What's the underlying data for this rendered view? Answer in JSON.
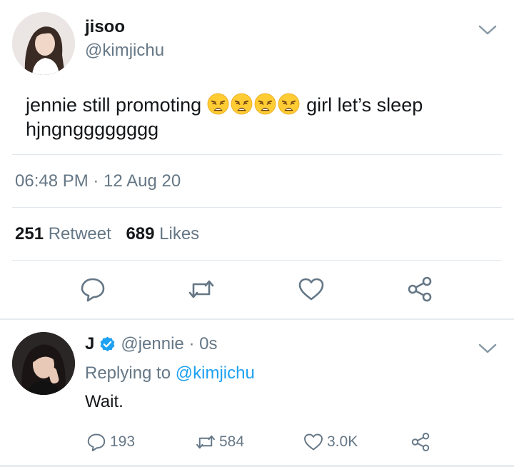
{
  "main_tweet": {
    "name": "jisoo",
    "handle": "@kimjichu",
    "text_before": "jennie still promoting ",
    "emoji_count": 4,
    "emoji_icon": "weary-face-emoji",
    "text_after": " girl let’s sleep hjngngggggggg",
    "timestamp": "06:48 PM · 12 Aug 20",
    "retweets_count": "251",
    "retweets_label": "Retweet",
    "likes_count": "689",
    "likes_label": "Likes",
    "actions": [
      "reply-icon",
      "retweet-icon",
      "like-icon",
      "share-icon"
    ]
  },
  "reply_tweet": {
    "name": "J",
    "verified": true,
    "handle_time": "@jennie · 0s",
    "replying_prefix": "Replying to ",
    "replying_to": "@kimjichu",
    "text": "Wait.",
    "reply_count": "193",
    "retweet_count": "584",
    "like_count": "3.0K"
  },
  "colors": {
    "text": "#14171a",
    "secondary": "#657786",
    "link": "#1da1f2",
    "divider": "#e1e8ed"
  }
}
